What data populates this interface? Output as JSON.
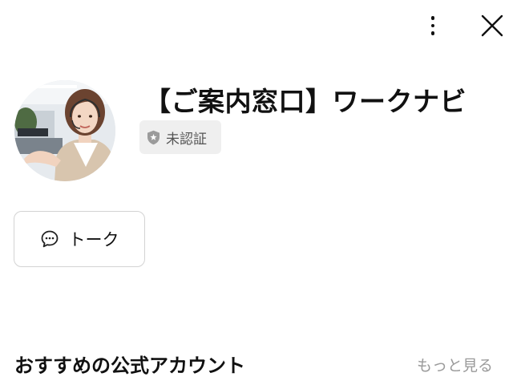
{
  "header": {
    "more_icon": "more-vertical-icon",
    "close_icon": "close-icon"
  },
  "profile": {
    "avatar": "person-photo",
    "name": "【ご案内窓口】ワークナビ",
    "badge": {
      "label": "未認証",
      "icon": "shield-star-icon"
    }
  },
  "actions": {
    "talk": {
      "label": "トーク",
      "icon": "chat-bubble-icon"
    }
  },
  "recommended": {
    "title": "おすすめの公式アカウント",
    "more_label": "もっと見る"
  },
  "colors": {
    "badge_bg": "#efefef",
    "muted_text": "#9a9a9a",
    "border": "#d3d3d3"
  }
}
